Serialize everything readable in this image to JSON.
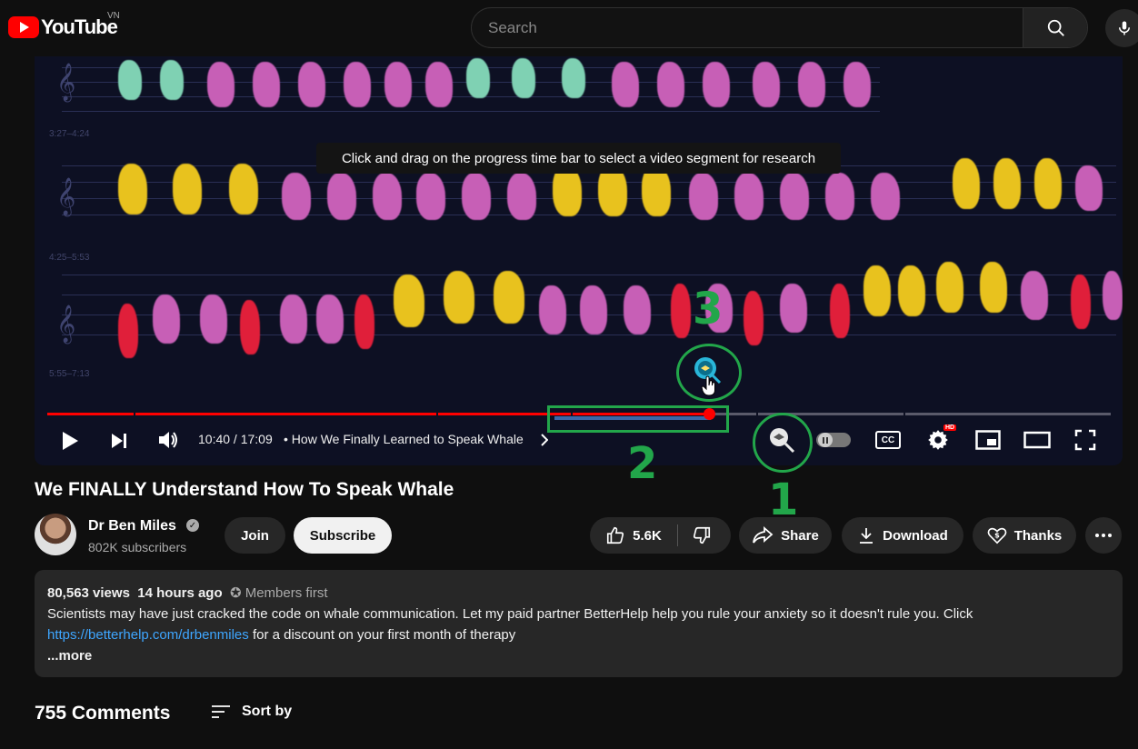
{
  "header": {
    "logo_text": "YouTube",
    "country": "VN",
    "search_placeholder": "Search"
  },
  "player": {
    "tooltip": "Click and drag on the progress time bar to select a video segment for research",
    "time": "10:40 / 17:09",
    "chapter": "• How We Finally Learned to Speak Whale",
    "progress_fraction": 0.622,
    "timecodes": [
      "3:27–4:24",
      "4:25–5:53",
      "5:55–7:13"
    ],
    "hd_badge": "HD",
    "cc_label": "CC"
  },
  "annotations": {
    "one": "1",
    "two": "2",
    "three": "3"
  },
  "video": {
    "title": "We FINALLY Understand How To Speak Whale",
    "channel": "Dr Ben Miles",
    "subscribers": "802K subscribers",
    "join_label": "Join",
    "subscribe_label": "Subscribe",
    "likes": "5.6K",
    "share_label": "Share",
    "download_label": "Download",
    "thanks_label": "Thanks"
  },
  "description": {
    "views": "80,563 views",
    "age": "14 hours ago",
    "members": "✪ Members first",
    "text1": "Scientists may have just cracked the code on whale communication. Let my paid partner BetterHelp help you rule your anxiety so it doesn't rule you.  Click",
    "link": "https://betterhelp.com/drbenmiles",
    "text2": " for a discount on your first month of therapy",
    "more": "...more"
  },
  "comments": {
    "count": "755 Comments",
    "sort_label": "Sort by"
  },
  "colors": {
    "accent_red": "#ff0000",
    "annotation_green": "#22a64a",
    "link_blue": "#3ea6ff"
  }
}
